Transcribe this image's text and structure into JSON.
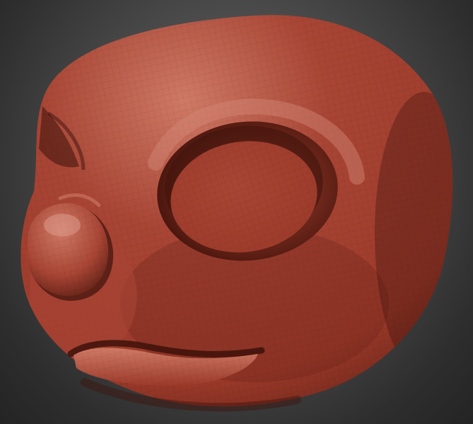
{
  "scene": {
    "subject": "sculpted-creature-head",
    "colors": {
      "clay_base": "#9c3a2a",
      "clay_light": "#cf7a66",
      "clay_mid": "#a84535",
      "clay_dark": "#5a1d13",
      "clay_deep": "#3d120b",
      "background_light": "#6a6a6a",
      "background_dark": "#242424"
    },
    "icons": {
      "head": "sculpt-head-shape",
      "eye": "eye-socket-shape",
      "nose": "nose-shape",
      "mouth": "mouth-lip-shape",
      "wireframe": "polygroup-wire-overlay"
    }
  }
}
